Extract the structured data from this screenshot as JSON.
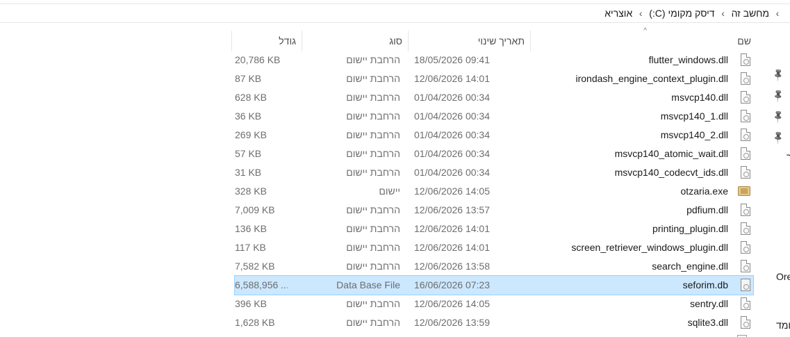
{
  "breadcrumb": {
    "items": [
      "מחשב זה",
      "דיסק מקומי (C:)",
      "אוצריא"
    ],
    "separator": "›"
  },
  "columns": {
    "name": "שם",
    "date": "תאריך שינוי",
    "type": "סוג",
    "size": "גודל",
    "sort_indicator": "^"
  },
  "files": [
    {
      "name": "flutter_windows.dll",
      "date": "18/05/2026 09:41",
      "type": "הרחבת יישום",
      "size": "20,786 KB",
      "icon": "dll-file-icon"
    },
    {
      "name": "irondash_engine_context_plugin.dll",
      "date": "12/06/2026 14:01",
      "type": "הרחבת יישום",
      "size": "87 KB",
      "icon": "dll-file-icon"
    },
    {
      "name": "msvcp140.dll",
      "date": "01/04/2026 00:34",
      "type": "הרחבת יישום",
      "size": "628 KB",
      "icon": "dll-file-icon"
    },
    {
      "name": "msvcp140_1.dll",
      "date": "01/04/2026 00:34",
      "type": "הרחבת יישום",
      "size": "36 KB",
      "icon": "dll-file-icon"
    },
    {
      "name": "msvcp140_2.dll",
      "date": "01/04/2026 00:34",
      "type": "הרחבת יישום",
      "size": "269 KB",
      "icon": "dll-file-icon"
    },
    {
      "name": "msvcp140_atomic_wait.dll",
      "date": "01/04/2026 00:34",
      "type": "הרחבת יישום",
      "size": "57 KB",
      "icon": "dll-file-icon"
    },
    {
      "name": "msvcp140_codecvt_ids.dll",
      "date": "01/04/2026 00:34",
      "type": "הרחבת יישום",
      "size": "31 KB",
      "icon": "dll-file-icon"
    },
    {
      "name": "otzaria.exe",
      "date": "12/06/2026 14:05",
      "type": "יישום",
      "size": "328 KB",
      "icon": "exe-app-icon"
    },
    {
      "name": "pdfium.dll",
      "date": "12/06/2026 13:57",
      "type": "הרחבת יישום",
      "size": "7,009 KB",
      "icon": "dll-file-icon"
    },
    {
      "name": "printing_plugin.dll",
      "date": "12/06/2026 14:01",
      "type": "הרחבת יישום",
      "size": "136 KB",
      "icon": "dll-file-icon"
    },
    {
      "name": "screen_retriever_windows_plugin.dll",
      "date": "12/06/2026 14:01",
      "type": "הרחבת יישום",
      "size": "117 KB",
      "icon": "dll-file-icon"
    },
    {
      "name": "search_engine.dll",
      "date": "12/06/2026 13:58",
      "type": "הרחבת יישום",
      "size": "7,582 KB",
      "icon": "dll-file-icon"
    },
    {
      "name": "seforim.db",
      "date": "16/06/2026 07:23",
      "type": "Data Base File",
      "size": "6,588,956 ...",
      "icon": "db-file-icon",
      "selected": true
    },
    {
      "name": "sentry.dll",
      "date": "12/06/2026 14:05",
      "type": "הרחבת יישום",
      "size": "396 KB",
      "icon": "dll-file-icon"
    },
    {
      "name": "sqlite3.dll",
      "date": "12/06/2026 13:59",
      "type": "הרחבת יישום",
      "size": "1,628 KB",
      "icon": "dll-file-icon"
    }
  ],
  "side_panel": {
    "pins": [
      "pin-icon",
      "pin-icon",
      "pin-icon",
      "pin-icon"
    ],
    "fragments": [
      "ך",
      "Ore",
      "ומד"
    ]
  },
  "colors": {
    "selected_bg": "#cce8ff",
    "selected_border": "#99d1ff",
    "muted_text": "#6d6d6d"
  }
}
